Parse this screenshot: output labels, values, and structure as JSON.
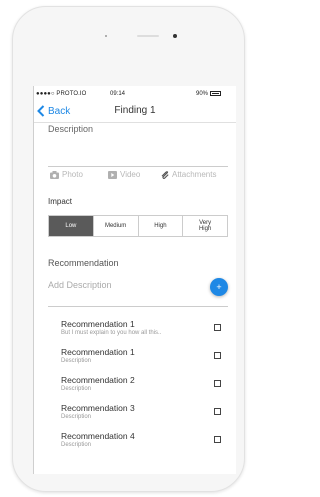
{
  "status_bar": {
    "carrier": "●●●●○ PROTO.IO",
    "time": "09:14",
    "battery": "90%"
  },
  "nav": {
    "back_label": "Back",
    "title": "Finding 1"
  },
  "description": {
    "label": "Description"
  },
  "media": {
    "photo_label": "Photo",
    "video_label": "Video",
    "attachments_label": "Attachments"
  },
  "impact": {
    "label": "Impact",
    "options": [
      "Low",
      "Medium",
      "High",
      "Very\nHigh"
    ],
    "selected": "Low"
  },
  "recommendation": {
    "label": "Recommendation",
    "placeholder": "Add Description",
    "add_button": "+"
  },
  "recommendations": [
    {
      "title": "Recommendation 1",
      "subtitle": "But I must explain to you how all this.."
    },
    {
      "title": "Recommendation 1",
      "subtitle": "Description"
    },
    {
      "title": "Recommendation 2",
      "subtitle": "Description"
    },
    {
      "title": "Recommendation 3",
      "subtitle": "Description"
    },
    {
      "title": "Recommendation 4",
      "subtitle": "Description"
    }
  ],
  "colors": {
    "accent": "#1e88e5",
    "selected_segment": "#5a5a5a"
  }
}
